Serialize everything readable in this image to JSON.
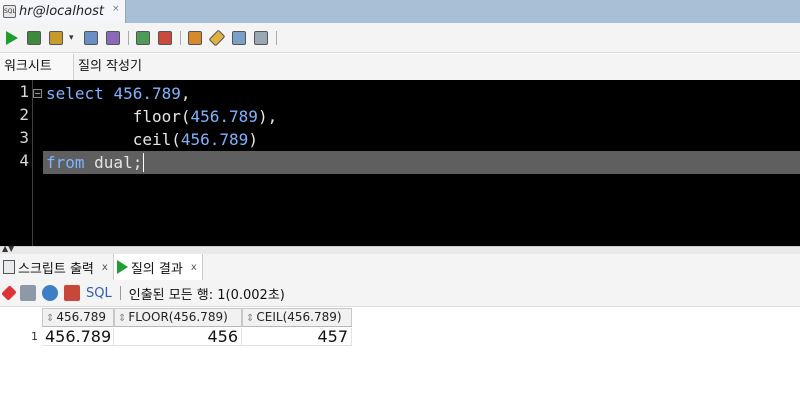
{
  "window": {
    "tab_title": "hr@localhost",
    "tab_close": "×",
    "db_icon_text": "SQL"
  },
  "toolbar": {
    "icons": [
      "run-statement-icon",
      "run-script-icon",
      "commit-icon",
      "dropdown-icon",
      "explain-plan-icon",
      "autotrace-icon",
      "sql-tuning-icon",
      "rollback-icon",
      "unshared-sql-icon",
      "eraser-icon",
      "history-icon",
      "format-icon"
    ]
  },
  "subtabs": {
    "worksheet": "워크시트",
    "query_builder": "질의 작성기"
  },
  "editor": {
    "line_numbers": [
      "1",
      "2",
      "3",
      "4"
    ],
    "lines": [
      {
        "kw": "select",
        "rest": " ",
        "num": "456.789",
        "tail": ","
      },
      {
        "indent": "         ",
        "fn": "floor(",
        "num": "456.789",
        "tail": "),"
      },
      {
        "indent": "         ",
        "fn": "ceil(",
        "num": "456.789",
        "tail": ")"
      },
      {
        "kw": "from",
        "rest": " dual;"
      }
    ],
    "fold_marker": "−"
  },
  "result_tabs": {
    "script_output": "스크립트 출력",
    "query_result": "질의 결과",
    "close": "x"
  },
  "result_toolbar": {
    "sql_link": "SQL",
    "status": "인출된 모든 행: 1(0.002초)"
  },
  "grid": {
    "columns": [
      "456.789",
      "FLOOR(456.789)",
      "CEIL(456.789)"
    ],
    "sort_glyph": "⇕",
    "rows": [
      {
        "rowno": "1",
        "values": [
          "456.789",
          "456",
          "457"
        ]
      }
    ]
  },
  "colors": {
    "editor_bg": "#000000",
    "keyword": "#7fb3ff",
    "current_line": "#5f5f5f",
    "tab_strip": "#a9bfd6",
    "run_green": "#1e9e2f"
  }
}
